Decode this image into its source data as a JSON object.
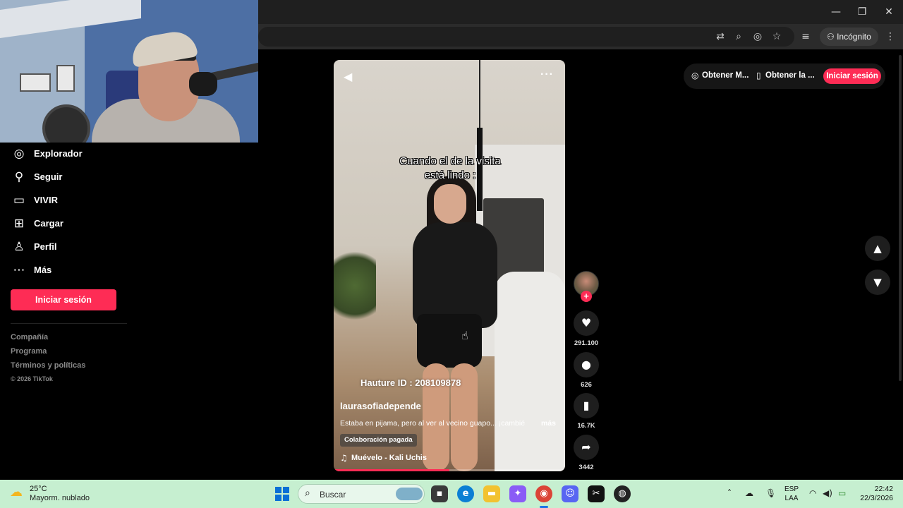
{
  "browser": {
    "incognito_label": "Incógnito",
    "controls": [
      "minimize-icon",
      "restore-icon",
      "close-icon"
    ],
    "toolbar_icons": [
      "translate-icon",
      "zoom-icon",
      "eye-off-icon",
      "star-icon",
      "tab-search-icon",
      "incognito-icon",
      "menu-icon"
    ]
  },
  "sidebar": {
    "items": [
      {
        "label": "Explorador",
        "icon": "compass-icon"
      },
      {
        "label": "Seguir",
        "icon": "user-follow-icon"
      },
      {
        "label": "VIVIR",
        "icon": "live-tv-icon"
      },
      {
        "label": "Cargar",
        "icon": "upload-plus-icon"
      },
      {
        "label": "Perfil",
        "icon": "profile-icon"
      },
      {
        "label": "Más",
        "icon": "more-dots-icon"
      }
    ],
    "login_label": "Iniciar sesión",
    "footer": {
      "links": [
        "Compañía",
        "Programa",
        "Términos y políticas"
      ],
      "copyright": "© 2026 TikTok"
    }
  },
  "video": {
    "caption_line1": "Cuando el de la visita",
    "caption_line2": "está lindo :",
    "overlay_id": "Hauture ID : 208109878",
    "username": "laurasofiadepende",
    "description": "Estaba en pijama, pero al ver al vecino guapo... ¡cambié",
    "more_label": "más",
    "badge": "Colaboración pagada",
    "music": "Muévelo - Kali Uchis",
    "progress": 0.5,
    "accent": "#fe2c55"
  },
  "actions": {
    "likes": "291.100",
    "comments": "626",
    "saves": "16.7K",
    "shares": "3442"
  },
  "topbar": {
    "get_app_label": "Obtener M...",
    "get_mobile_label": "Obtener la ...",
    "login_label": "Iniciar sesión"
  },
  "taskbar": {
    "temp": "25°C",
    "condition": "Mayorm. nublado",
    "search_label": "Buscar",
    "lang_line1": "ESP",
    "lang_line2": "LAA",
    "time": "22:42",
    "date": "22/3/2026"
  }
}
